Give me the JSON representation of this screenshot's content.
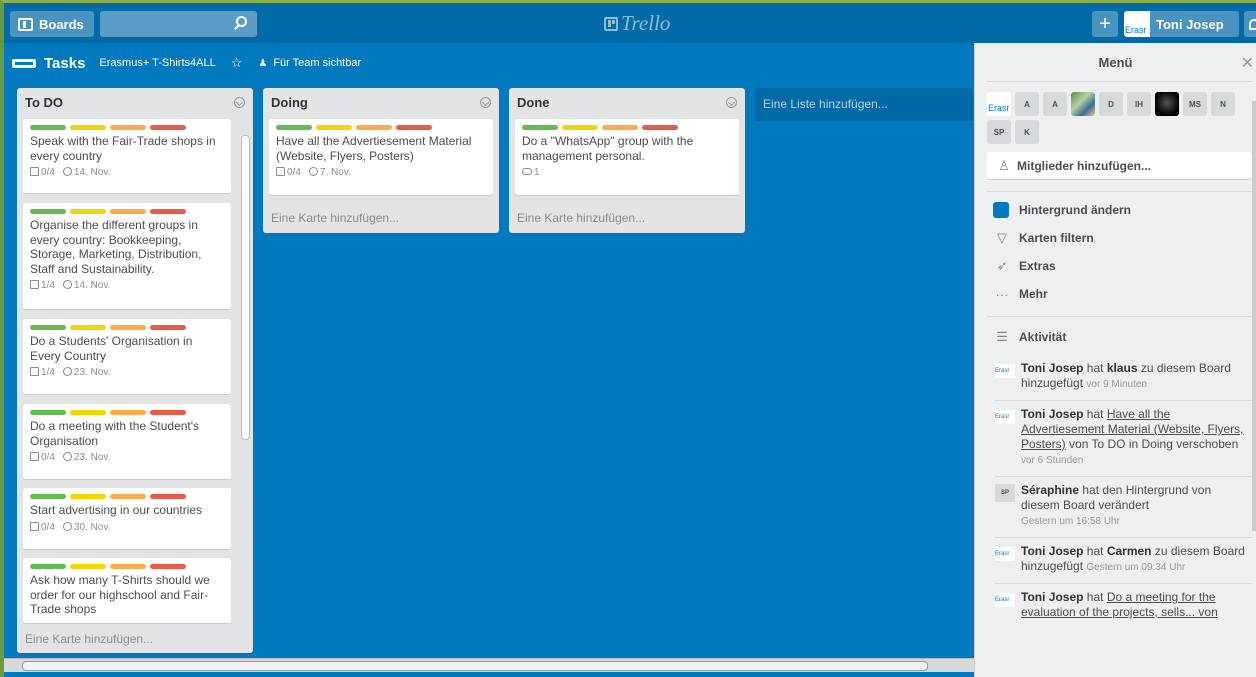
{
  "header": {
    "boards_label": "Boards",
    "search_placeholder": "",
    "logo_text": "Trello",
    "user_name": "Toni Josep",
    "user_avatar_text": "Erasr"
  },
  "board": {
    "title": "Tasks",
    "team": "Erasmus+ T-Shirts4ALL",
    "visibility": "Für Team sichtbar"
  },
  "lists": [
    {
      "name": "To DO",
      "add_card": "Eine Karte hinzufügen...",
      "cards": [
        {
          "title": "Speak with the Fair-Trade shops in every country",
          "checklist": "0/4",
          "due": "14. Nov."
        },
        {
          "title": "Organise the different groups in every country: Bookkeeping, Storage, Marketing, Distribution, Staff and Sustainability.",
          "checklist": "1/4",
          "due": "14. Nov."
        },
        {
          "title": "Do a Students' Organisation in Every Country",
          "checklist": "1/4",
          "due": "23. Nov."
        },
        {
          "title": "Do a meeting with the Student's Organisation",
          "checklist": "0/4",
          "due": "23. Nov."
        },
        {
          "title": "Start advertising in our countries",
          "checklist": "0/4",
          "due": "30. Nov."
        },
        {
          "title": "Ask how many T-Shirts should we order for our highschool and Fair-Trade shops"
        }
      ]
    },
    {
      "name": "Doing",
      "add_card": "Eine Karte hinzufügen...",
      "cards": [
        {
          "title": "Have all the Advertiesement Material (Website, Flyers, Posters)",
          "checklist": "0/4",
          "due": "7. Nov."
        }
      ]
    },
    {
      "name": "Done",
      "add_card": "Eine Karte hinzufügen...",
      "cards": [
        {
          "title": "Do a \"WhatsApp\" group with the management personal.",
          "comments": "1"
        }
      ]
    }
  ],
  "add_list": "Eine Liste hinzufügen...",
  "menu": {
    "title": "Menü",
    "members": [
      "Erasr",
      "A",
      "A",
      "",
      "D",
      "IH",
      "",
      "MS",
      "N",
      "SP",
      "K"
    ],
    "add_members": "Mitglieder hinzufügen...",
    "items": [
      "Hintergrund ändern",
      "Karten filtern",
      "Extras",
      "Mehr"
    ],
    "activity_title": "Aktivität",
    "activities": [
      {
        "avatar": "Erasr",
        "user": "Toni Josep",
        "pre": "hat",
        "strong": "klaus",
        "post": "zu diesem Board hinzugefügt",
        "time": "vor 9 Minuten"
      },
      {
        "avatar": "Erasr",
        "user": "Toni Josep",
        "pre": "hat",
        "link": "Have all the Advertiesement Material (Website, Flyers, Posters)",
        "post": "von To DO in Doing verschoben",
        "time": "vor 6 Stunden"
      },
      {
        "avatar": "SP",
        "user": "Séraphine",
        "pre": "hat den Hintergrund von diesem Board verändert",
        "time": "Gestern um 16:58 Uhr"
      },
      {
        "avatar": "Erasr",
        "user": "Toni Josep",
        "pre": "hat",
        "strong": "Carmen",
        "post": "zu diesem Board hinzugefügt",
        "time": "Gestern um 09:34 Uhr"
      },
      {
        "avatar": "Erasr",
        "user": "Toni Josep",
        "pre": "hat",
        "link": "Do a meeting for the evaluation of the projects, sells... von"
      }
    ]
  },
  "colors": {
    "board_bg": "#0079bf",
    "header_bg": "#026aa7",
    "label_green": "#61bd4f",
    "label_yellow": "#f2d600",
    "label_orange": "#ffab4a",
    "label_red": "#eb5a46"
  }
}
